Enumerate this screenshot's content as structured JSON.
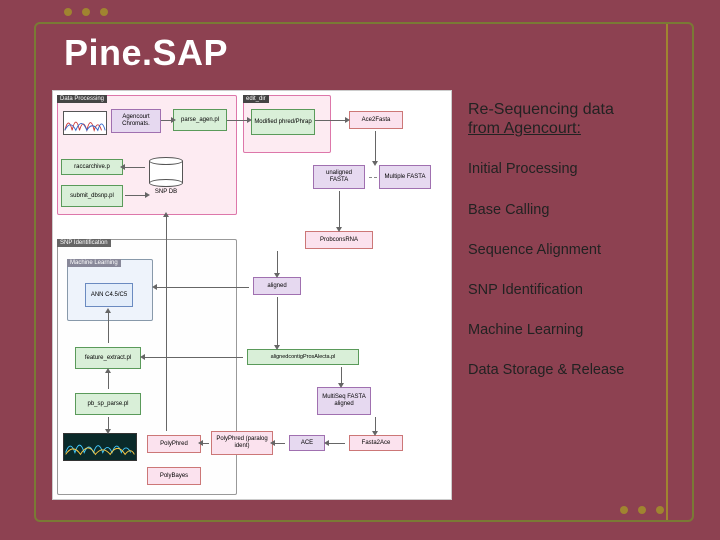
{
  "title": "Pine.SAP",
  "text": {
    "heading_l1": "Re-Sequencing data",
    "heading_l2": "from Agencourt:",
    "items": [
      "Initial Processing",
      "Base Calling",
      "Sequence Alignment",
      "SNP Identification",
      "Machine Learning",
      "Data Storage & Release"
    ]
  },
  "diagram": {
    "panels": {
      "data_processing": "Data Processing",
      "edit_dir": "edit_dir",
      "snp_ident": "SNP Identification"
    },
    "nodes": {
      "agencourt": "Agencourt Chromats.",
      "parse_agen": "parse_agen.pl",
      "modified_phred": "Modified phred/Phrap",
      "ace2fasta": "Ace2Fasta",
      "raccarchive": "raccarchive.p",
      "submit_dbsnp": "submit_dbsnp.pl",
      "snp_db": "SNP DB",
      "unaligned_fasta": "unaligned FASTA",
      "multiple_fasta": "Multiple FASTA",
      "probcons": "ProbconsRNA",
      "machine_learning": "Machine Learning",
      "ann": "ANN C4.5/C5",
      "aligned": "aligned",
      "feature_extract": "feature_extract.pl",
      "aligned_contig": "alignedcontigProsAlecta.pl",
      "pb_sp_parse": "pb_sp_parse.pl",
      "multiseq_fasta": "MultiSeq FASTA aligned",
      "polyphred": "PolyPhred",
      "polyphred_paralog": "PolyPhred (paralog ident)",
      "ace": "ACE",
      "fasta2ace": "Fasta2Ace",
      "polybayes": "PolyBayes"
    }
  }
}
